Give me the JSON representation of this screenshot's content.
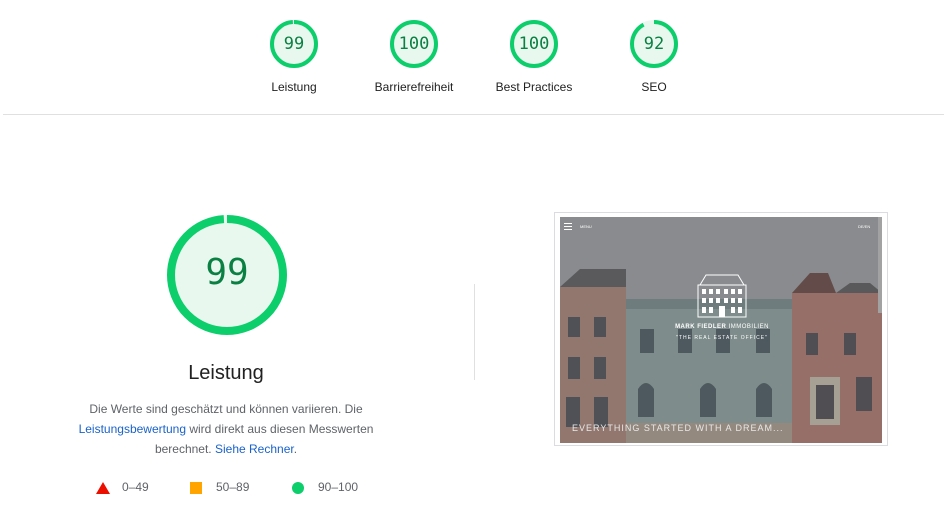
{
  "summary": {
    "gauges": [
      {
        "score": "99",
        "label": "Leistung",
        "fraction": 0.99
      },
      {
        "score": "100",
        "label": "Barrierefreiheit",
        "fraction": 1.0
      },
      {
        "score": "100",
        "label": "Best Practices",
        "fraction": 1.0
      },
      {
        "score": "92",
        "label": "SEO",
        "fraction": 0.92
      }
    ]
  },
  "main": {
    "score": "99",
    "fraction": 0.99,
    "title": "Leistung",
    "desc_before": "Die Werte sind geschätzt und können variieren. Die",
    "desc_link1": "Leistungsbewertung",
    "desc_middle": " wird direkt aus diesen Messwerten berechnet. ",
    "desc_link2": "Siehe Rechner",
    "desc_end": "."
  },
  "legend": {
    "fail": "0–49",
    "average": "50–89",
    "pass": "90–100"
  },
  "screenshot": {
    "menu_label": "MENU",
    "corner_label": "DE/EN",
    "brand_bold": "MARK FIEDLER",
    "brand_regular": " IMMOBILIEN",
    "tagline": "\"THE REAL ESTATE OFFICE\"",
    "slogan": "EVERYTHING STARTED WITH A DREAM..."
  },
  "colors": {
    "pass": "#0cce6b",
    "pass_text": "#0b8043",
    "pass_fill": "#e8f8ef",
    "average": "#ffa400",
    "fail": "#ff4e42",
    "link": "#1a62c9"
  }
}
